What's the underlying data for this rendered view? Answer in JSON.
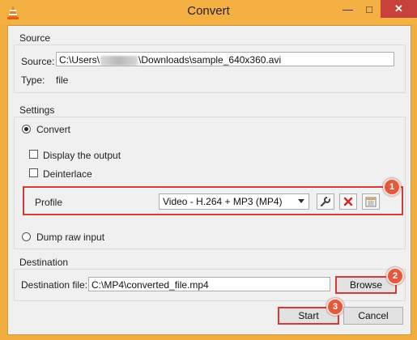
{
  "window": {
    "title": "Convert"
  },
  "titlebar": {
    "minimize": "—",
    "maximize": "□",
    "close": "✕"
  },
  "source": {
    "group_label": "Source",
    "source_label": "Source:",
    "path_prefix": "C:\\Users\\",
    "path_suffix": "\\Downloads\\sample_640x360.avi",
    "type_label": "Type:",
    "type_value": "file"
  },
  "settings": {
    "group_label": "Settings",
    "convert_label": "Convert",
    "display_output_label": "Display the output",
    "deinterlace_label": "Deinterlace",
    "profile_label": "Profile",
    "profile_value": "Video - H.264 + MP3 (MP4)",
    "dump_raw_label": "Dump raw input"
  },
  "destination": {
    "group_label": "Destination",
    "file_label": "Destination file:",
    "file_value": "C:\\MP4\\converted_file.mp4",
    "browse_label": "Browse"
  },
  "footer": {
    "start_label": "Start",
    "cancel_label": "Cancel"
  },
  "markers": {
    "one": "1",
    "two": "2",
    "three": "3"
  },
  "colors": {
    "titlebar": "#f4b042",
    "highlight": "#d43a3a",
    "marker": "#e2593d"
  }
}
